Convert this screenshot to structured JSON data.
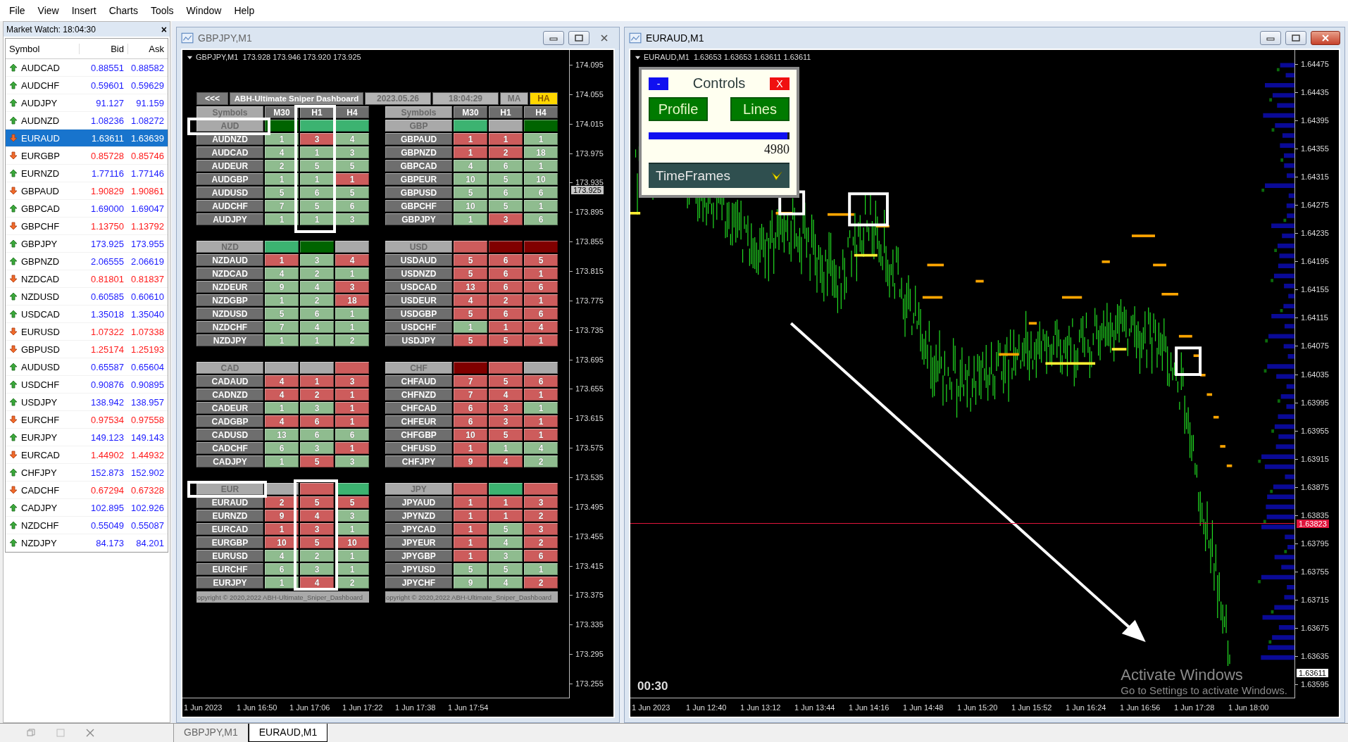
{
  "menu": [
    "File",
    "View",
    "Insert",
    "Charts",
    "Tools",
    "Window",
    "Help"
  ],
  "market_watch": {
    "title": "Market Watch: 18:04:30",
    "close": "×",
    "columns": [
      "Symbol",
      "Bid",
      "Ask"
    ],
    "rows": [
      {
        "symbol": "AUDCAD",
        "kind": "up",
        "bid": "0.88551",
        "ask": "0.88582",
        "selected": false
      },
      {
        "symbol": "AUDCHF",
        "kind": "up",
        "bid": "0.59601",
        "ask": "0.59629",
        "selected": false
      },
      {
        "symbol": "AUDJPY",
        "kind": "up",
        "bid": "91.127",
        "ask": "91.159",
        "selected": false
      },
      {
        "symbol": "AUDNZD",
        "kind": "up",
        "bid": "1.08236",
        "ask": "1.08272",
        "selected": false
      },
      {
        "symbol": "EURAUD",
        "kind": "down",
        "bid": "1.63611",
        "ask": "1.63639",
        "selected": true
      },
      {
        "symbol": "EURGBP",
        "kind": "down",
        "bid": "0.85728",
        "ask": "0.85746",
        "selected": false
      },
      {
        "symbol": "EURNZD",
        "kind": "up",
        "bid": "1.77116",
        "ask": "1.77146",
        "selected": false
      },
      {
        "symbol": "GBPAUD",
        "kind": "down",
        "bid": "1.90829",
        "ask": "1.90861",
        "selected": false
      },
      {
        "symbol": "GBPCAD",
        "kind": "up",
        "bid": "1.69000",
        "ask": "1.69047",
        "selected": false
      },
      {
        "symbol": "GBPCHF",
        "kind": "down",
        "bid": "1.13750",
        "ask": "1.13792",
        "selected": false
      },
      {
        "symbol": "GBPJPY",
        "kind": "up",
        "bid": "173.925",
        "ask": "173.955",
        "selected": false
      },
      {
        "symbol": "GBPNZD",
        "kind": "up",
        "bid": "2.06555",
        "ask": "2.06619",
        "selected": false
      },
      {
        "symbol": "NZDCAD",
        "kind": "down",
        "bid": "0.81801",
        "ask": "0.81837",
        "selected": false
      },
      {
        "symbol": "NZDUSD",
        "kind": "up",
        "bid": "0.60585",
        "ask": "0.60610",
        "selected": false
      },
      {
        "symbol": "USDCAD",
        "kind": "up",
        "bid": "1.35018",
        "ask": "1.35040",
        "selected": false
      },
      {
        "symbol": "EURUSD",
        "kind": "down",
        "bid": "1.07322",
        "ask": "1.07338",
        "selected": false
      },
      {
        "symbol": "GBPUSD",
        "kind": "down",
        "bid": "1.25174",
        "ask": "1.25193",
        "selected": false
      },
      {
        "symbol": "AUDUSD",
        "kind": "up",
        "bid": "0.65587",
        "ask": "0.65604",
        "selected": false
      },
      {
        "symbol": "USDCHF",
        "kind": "up",
        "bid": "0.90876",
        "ask": "0.90895",
        "selected": false
      },
      {
        "symbol": "USDJPY",
        "kind": "up",
        "bid": "138.942",
        "ask": "138.957",
        "selected": false
      },
      {
        "symbol": "EURCHF",
        "kind": "down",
        "bid": "0.97534",
        "ask": "0.97558",
        "selected": false
      },
      {
        "symbol": "EURJPY",
        "kind": "up",
        "bid": "149.123",
        "ask": "149.143",
        "selected": false
      },
      {
        "symbol": "EURCAD",
        "kind": "down",
        "bid": "1.44902",
        "ask": "1.44932",
        "selected": false
      },
      {
        "symbol": "CHFJPY",
        "kind": "up",
        "bid": "152.873",
        "ask": "152.902",
        "selected": false
      },
      {
        "symbol": "CADCHF",
        "kind": "down",
        "bid": "0.67294",
        "ask": "0.67328",
        "selected": false
      },
      {
        "symbol": "CADJPY",
        "kind": "up",
        "bid": "102.895",
        "ask": "102.926",
        "selected": false
      },
      {
        "symbol": "NZDCHF",
        "kind": "up",
        "bid": "0.55049",
        "ask": "0.55087",
        "selected": false
      },
      {
        "symbol": "NZDJPY",
        "kind": "up",
        "bid": "84.173",
        "ask": "84.201",
        "selected": false
      }
    ]
  },
  "charts": [
    {
      "title": "GBPJPY,M1",
      "info": "GBPJPY,M1  173.928 173.946 173.920 173.925",
      "price_ticks": [
        "174.095",
        "174.055",
        "174.015",
        "173.975",
        "173.935",
        "173.895",
        "173.855",
        "173.815",
        "173.775",
        "173.735",
        "173.695",
        "173.655",
        "173.615",
        "173.575",
        "173.535",
        "173.495",
        "173.455",
        "173.415",
        "173.375",
        "173.335",
        "173.295",
        "173.255"
      ],
      "current_price": "173.925",
      "time_ticks": [
        "1 Jun 2023",
        "1 Jun 16:50",
        "1 Jun 17:06",
        "1 Jun 17:22",
        "1 Jun 17:38",
        "1 Jun 17:54"
      ],
      "dashboard": {
        "back": "<<<",
        "title": "ABH-Ultimate Sniper Dashboard",
        "date": "2023.05.26",
        "time": "18:04:29",
        "modes": [
          {
            "label": "MA",
            "selected": false
          },
          {
            "label": "HA",
            "selected": true
          }
        ],
        "heads": [
          [
            "Symbols",
            "M30",
            "H1",
            "H4"
          ],
          [
            "Symbols",
            "M30",
            "H1",
            "H4"
          ]
        ],
        "groups": [
          {
            "currency": "AUD",
            "strength": [
              {
                "color": "#006400"
              },
              {
                "color": "#3cb371"
              },
              {
                "color": "#3cb371"
              }
            ],
            "rows": [
              {
                "pair": "AUDNZD",
                "cells": [
                  {
                    "text": "1",
                    "color": "#8fbc8f"
                  },
                  {
                    "text": "3",
                    "color": "#cd5c5c"
                  },
                  {
                    "text": "4",
                    "color": "#8fbc8f"
                  }
                ]
              },
              {
                "pair": "AUDCAD",
                "cells": [
                  {
                    "text": "4",
                    "color": "#8fbc8f"
                  },
                  {
                    "text": "1",
                    "color": "#8fbc8f"
                  },
                  {
                    "text": "3",
                    "color": "#8fbc8f"
                  }
                ]
              },
              {
                "pair": "AUDEUR",
                "cells": [
                  {
                    "text": "2",
                    "color": "#8fbc8f"
                  },
                  {
                    "text": "5",
                    "color": "#8fbc8f"
                  },
                  {
                    "text": "5",
                    "color": "#8fbc8f"
                  }
                ]
              },
              {
                "pair": "AUDGBP",
                "cells": [
                  {
                    "text": "1",
                    "color": "#8fbc8f"
                  },
                  {
                    "text": "1",
                    "color": "#8fbc8f"
                  },
                  {
                    "text": "1",
                    "color": "#cd5c5c"
                  }
                ]
              },
              {
                "pair": "AUDUSD",
                "cells": [
                  {
                    "text": "5",
                    "color": "#8fbc8f"
                  },
                  {
                    "text": "6",
                    "color": "#8fbc8f"
                  },
                  {
                    "text": "5",
                    "color": "#8fbc8f"
                  }
                ]
              },
              {
                "pair": "AUDCHF",
                "cells": [
                  {
                    "text": "7",
                    "color": "#8fbc8f"
                  },
                  {
                    "text": "5",
                    "color": "#8fbc8f"
                  },
                  {
                    "text": "6",
                    "color": "#8fbc8f"
                  }
                ]
              },
              {
                "pair": "AUDJPY",
                "cells": [
                  {
                    "text": "1",
                    "color": "#8fbc8f"
                  },
                  {
                    "text": "1",
                    "color": "#8fbc8f"
                  },
                  {
                    "text": "3",
                    "color": "#8fbc8f"
                  }
                ]
              }
            ]
          },
          {
            "currency": "GBP",
            "strength": [
              {
                "color": "#3cb371"
              },
              {
                "color": "#a9a9a9"
              },
              {
                "color": "#006400"
              }
            ],
            "rows": [
              {
                "pair": "GBPAUD",
                "cells": [
                  {
                    "text": "1",
                    "color": "#cd5c5c"
                  },
                  {
                    "text": "1",
                    "color": "#cd5c5c"
                  },
                  {
                    "text": "1",
                    "color": "#8fbc8f"
                  }
                ]
              },
              {
                "pair": "GBPNZD",
                "cells": [
                  {
                    "text": "1",
                    "color": "#cd5c5c"
                  },
                  {
                    "text": "2",
                    "color": "#cd5c5c"
                  },
                  {
                    "text": "18",
                    "color": "#8fbc8f"
                  }
                ]
              },
              {
                "pair": "GBPCAD",
                "cells": [
                  {
                    "text": "4",
                    "color": "#8fbc8f"
                  },
                  {
                    "text": "6",
                    "color": "#8fbc8f"
                  },
                  {
                    "text": "1",
                    "color": "#8fbc8f"
                  }
                ]
              },
              {
                "pair": "GBPEUR",
                "cells": [
                  {
                    "text": "10",
                    "color": "#8fbc8f"
                  },
                  {
                    "text": "5",
                    "color": "#8fbc8f"
                  },
                  {
                    "text": "10",
                    "color": "#8fbc8f"
                  }
                ]
              },
              {
                "pair": "GBPUSD",
                "cells": [
                  {
                    "text": "5",
                    "color": "#8fbc8f"
                  },
                  {
                    "text": "6",
                    "color": "#8fbc8f"
                  },
                  {
                    "text": "6",
                    "color": "#8fbc8f"
                  }
                ]
              },
              {
                "pair": "GBPCHF",
                "cells": [
                  {
                    "text": "10",
                    "color": "#8fbc8f"
                  },
                  {
                    "text": "5",
                    "color": "#8fbc8f"
                  },
                  {
                    "text": "1",
                    "color": "#8fbc8f"
                  }
                ]
              },
              {
                "pair": "GBPJPY",
                "cells": [
                  {
                    "text": "1",
                    "color": "#8fbc8f"
                  },
                  {
                    "text": "3",
                    "color": "#cd5c5c"
                  },
                  {
                    "text": "6",
                    "color": "#8fbc8f"
                  }
                ]
              }
            ]
          },
          {
            "currency": "NZD",
            "strength": [
              {
                "color": "#3cb371"
              },
              {
                "color": "#006400"
              },
              {
                "color": "#a9a9a9"
              }
            ],
            "rows": [
              {
                "pair": "NZDAUD",
                "cells": [
                  {
                    "text": "1",
                    "color": "#cd5c5c"
                  },
                  {
                    "text": "3",
                    "color": "#8fbc8f"
                  },
                  {
                    "text": "4",
                    "color": "#cd5c5c"
                  }
                ]
              },
              {
                "pair": "NZDCAD",
                "cells": [
                  {
                    "text": "4",
                    "color": "#8fbc8f"
                  },
                  {
                    "text": "2",
                    "color": "#8fbc8f"
                  },
                  {
                    "text": "1",
                    "color": "#8fbc8f"
                  }
                ]
              },
              {
                "pair": "NZDEUR",
                "cells": [
                  {
                    "text": "9",
                    "color": "#8fbc8f"
                  },
                  {
                    "text": "4",
                    "color": "#8fbc8f"
                  },
                  {
                    "text": "3",
                    "color": "#cd5c5c"
                  }
                ]
              },
              {
                "pair": "NZDGBP",
                "cells": [
                  {
                    "text": "1",
                    "color": "#8fbc8f"
                  },
                  {
                    "text": "2",
                    "color": "#8fbc8f"
                  },
                  {
                    "text": "18",
                    "color": "#cd5c5c"
                  }
                ]
              },
              {
                "pair": "NZDUSD",
                "cells": [
                  {
                    "text": "5",
                    "color": "#8fbc8f"
                  },
                  {
                    "text": "6",
                    "color": "#8fbc8f"
                  },
                  {
                    "text": "1",
                    "color": "#8fbc8f"
                  }
                ]
              },
              {
                "pair": "NZDCHF",
                "cells": [
                  {
                    "text": "7",
                    "color": "#8fbc8f"
                  },
                  {
                    "text": "4",
                    "color": "#8fbc8f"
                  },
                  {
                    "text": "1",
                    "color": "#8fbc8f"
                  }
                ]
              },
              {
                "pair": "NZDJPY",
                "cells": [
                  {
                    "text": "1",
                    "color": "#8fbc8f"
                  },
                  {
                    "text": "1",
                    "color": "#8fbc8f"
                  },
                  {
                    "text": "2",
                    "color": "#8fbc8f"
                  }
                ]
              }
            ]
          },
          {
            "currency": "USD",
            "strength": [
              {
                "color": "#cd5c5c"
              },
              {
                "color": "#800000"
              },
              {
                "color": "#800000"
              }
            ],
            "rows": [
              {
                "pair": "USDAUD",
                "cells": [
                  {
                    "text": "5",
                    "color": "#cd5c5c"
                  },
                  {
                    "text": "6",
                    "color": "#cd5c5c"
                  },
                  {
                    "text": "5",
                    "color": "#cd5c5c"
                  }
                ]
              },
              {
                "pair": "USDNZD",
                "cells": [
                  {
                    "text": "5",
                    "color": "#cd5c5c"
                  },
                  {
                    "text": "6",
                    "color": "#cd5c5c"
                  },
                  {
                    "text": "1",
                    "color": "#cd5c5c"
                  }
                ]
              },
              {
                "pair": "USDCAD",
                "cells": [
                  {
                    "text": "13",
                    "color": "#cd5c5c"
                  },
                  {
                    "text": "6",
                    "color": "#cd5c5c"
                  },
                  {
                    "text": "6",
                    "color": "#cd5c5c"
                  }
                ]
              },
              {
                "pair": "USDEUR",
                "cells": [
                  {
                    "text": "4",
                    "color": "#cd5c5c"
                  },
                  {
                    "text": "2",
                    "color": "#cd5c5c"
                  },
                  {
                    "text": "1",
                    "color": "#cd5c5c"
                  }
                ]
              },
              {
                "pair": "USDGBP",
                "cells": [
                  {
                    "text": "5",
                    "color": "#cd5c5c"
                  },
                  {
                    "text": "6",
                    "color": "#cd5c5c"
                  },
                  {
                    "text": "6",
                    "color": "#cd5c5c"
                  }
                ]
              },
              {
                "pair": "USDCHF",
                "cells": [
                  {
                    "text": "1",
                    "color": "#8fbc8f"
                  },
                  {
                    "text": "1",
                    "color": "#cd5c5c"
                  },
                  {
                    "text": "4",
                    "color": "#cd5c5c"
                  }
                ]
              },
              {
                "pair": "USDJPY",
                "cells": [
                  {
                    "text": "5",
                    "color": "#cd5c5c"
                  },
                  {
                    "text": "5",
                    "color": "#cd5c5c"
                  },
                  {
                    "text": "1",
                    "color": "#cd5c5c"
                  }
                ]
              }
            ]
          },
          {
            "currency": "CAD",
            "strength": [
              {
                "color": "#a9a9a9"
              },
              {
                "color": "#a9a9a9"
              },
              {
                "color": "#cd5c5c"
              }
            ],
            "rows": [
              {
                "pair": "CADAUD",
                "cells": [
                  {
                    "text": "4",
                    "color": "#cd5c5c"
                  },
                  {
                    "text": "1",
                    "color": "#cd5c5c"
                  },
                  {
                    "text": "3",
                    "color": "#cd5c5c"
                  }
                ]
              },
              {
                "pair": "CADNZD",
                "cells": [
                  {
                    "text": "4",
                    "color": "#cd5c5c"
                  },
                  {
                    "text": "2",
                    "color": "#cd5c5c"
                  },
                  {
                    "text": "1",
                    "color": "#cd5c5c"
                  }
                ]
              },
              {
                "pair": "CADEUR",
                "cells": [
                  {
                    "text": "1",
                    "color": "#8fbc8f"
                  },
                  {
                    "text": "3",
                    "color": "#8fbc8f"
                  },
                  {
                    "text": "1",
                    "color": "#cd5c5c"
                  }
                ]
              },
              {
                "pair": "CADGBP",
                "cells": [
                  {
                    "text": "4",
                    "color": "#cd5c5c"
                  },
                  {
                    "text": "6",
                    "color": "#cd5c5c"
                  },
                  {
                    "text": "1",
                    "color": "#cd5c5c"
                  }
                ]
              },
              {
                "pair": "CADUSD",
                "cells": [
                  {
                    "text": "13",
                    "color": "#8fbc8f"
                  },
                  {
                    "text": "6",
                    "color": "#8fbc8f"
                  },
                  {
                    "text": "6",
                    "color": "#8fbc8f"
                  }
                ]
              },
              {
                "pair": "CADCHF",
                "cells": [
                  {
                    "text": "6",
                    "color": "#8fbc8f"
                  },
                  {
                    "text": "3",
                    "color": "#8fbc8f"
                  },
                  {
                    "text": "1",
                    "color": "#cd5c5c"
                  }
                ]
              },
              {
                "pair": "CADJPY",
                "cells": [
                  {
                    "text": "1",
                    "color": "#8fbc8f"
                  },
                  {
                    "text": "5",
                    "color": "#cd5c5c"
                  },
                  {
                    "text": "3",
                    "color": "#8fbc8f"
                  }
                ]
              }
            ]
          },
          {
            "currency": "CHF",
            "strength": [
              {
                "color": "#800000"
              },
              {
                "color": "#cd5c5c"
              },
              {
                "color": "#a9a9a9"
              }
            ],
            "rows": [
              {
                "pair": "CHFAUD",
                "cells": [
                  {
                    "text": "7",
                    "color": "#cd5c5c"
                  },
                  {
                    "text": "5",
                    "color": "#cd5c5c"
                  },
                  {
                    "text": "6",
                    "color": "#cd5c5c"
                  }
                ]
              },
              {
                "pair": "CHFNZD",
                "cells": [
                  {
                    "text": "7",
                    "color": "#cd5c5c"
                  },
                  {
                    "text": "4",
                    "color": "#cd5c5c"
                  },
                  {
                    "text": "1",
                    "color": "#cd5c5c"
                  }
                ]
              },
              {
                "pair": "CHFCAD",
                "cells": [
                  {
                    "text": "6",
                    "color": "#cd5c5c"
                  },
                  {
                    "text": "3",
                    "color": "#cd5c5c"
                  },
                  {
                    "text": "1",
                    "color": "#8fbc8f"
                  }
                ]
              },
              {
                "pair": "CHFEUR",
                "cells": [
                  {
                    "text": "6",
                    "color": "#cd5c5c"
                  },
                  {
                    "text": "3",
                    "color": "#cd5c5c"
                  },
                  {
                    "text": "1",
                    "color": "#cd5c5c"
                  }
                ]
              },
              {
                "pair": "CHFGBP",
                "cells": [
                  {
                    "text": "10",
                    "color": "#cd5c5c"
                  },
                  {
                    "text": "5",
                    "color": "#cd5c5c"
                  },
                  {
                    "text": "1",
                    "color": "#cd5c5c"
                  }
                ]
              },
              {
                "pair": "CHFUSD",
                "cells": [
                  {
                    "text": "1",
                    "color": "#cd5c5c"
                  },
                  {
                    "text": "1",
                    "color": "#8fbc8f"
                  },
                  {
                    "text": "4",
                    "color": "#8fbc8f"
                  }
                ]
              },
              {
                "pair": "CHFJPY",
                "cells": [
                  {
                    "text": "9",
                    "color": "#cd5c5c"
                  },
                  {
                    "text": "4",
                    "color": "#cd5c5c"
                  },
                  {
                    "text": "2",
                    "color": "#8fbc8f"
                  }
                ]
              }
            ]
          },
          {
            "currency": "EUR",
            "strength": [
              {
                "color": "#a9a9a9"
              },
              {
                "color": "#cd5c5c"
              },
              {
                "color": "#3cb371"
              }
            ],
            "rows": [
              {
                "pair": "EURAUD",
                "cells": [
                  {
                    "text": "2",
                    "color": "#cd5c5c"
                  },
                  {
                    "text": "5",
                    "color": "#cd5c5c"
                  },
                  {
                    "text": "5",
                    "color": "#cd5c5c"
                  }
                ]
              },
              {
                "pair": "EURNZD",
                "cells": [
                  {
                    "text": "9",
                    "color": "#cd5c5c"
                  },
                  {
                    "text": "4",
                    "color": "#cd5c5c"
                  },
                  {
                    "text": "3",
                    "color": "#8fbc8f"
                  }
                ]
              },
              {
                "pair": "EURCAD",
                "cells": [
                  {
                    "text": "1",
                    "color": "#cd5c5c"
                  },
                  {
                    "text": "3",
                    "color": "#cd5c5c"
                  },
                  {
                    "text": "1",
                    "color": "#8fbc8f"
                  }
                ]
              },
              {
                "pair": "EURGBP",
                "cells": [
                  {
                    "text": "10",
                    "color": "#cd5c5c"
                  },
                  {
                    "text": "5",
                    "color": "#cd5c5c"
                  },
                  {
                    "text": "10",
                    "color": "#cd5c5c"
                  }
                ]
              },
              {
                "pair": "EURUSD",
                "cells": [
                  {
                    "text": "4",
                    "color": "#8fbc8f"
                  },
                  {
                    "text": "2",
                    "color": "#8fbc8f"
                  },
                  {
                    "text": "1",
                    "color": "#8fbc8f"
                  }
                ]
              },
              {
                "pair": "EURCHF",
                "cells": [
                  {
                    "text": "6",
                    "color": "#8fbc8f"
                  },
                  {
                    "text": "3",
                    "color": "#8fbc8f"
                  },
                  {
                    "text": "1",
                    "color": "#8fbc8f"
                  }
                ]
              },
              {
                "pair": "EURJPY",
                "cells": [
                  {
                    "text": "1",
                    "color": "#8fbc8f"
                  },
                  {
                    "text": "4",
                    "color": "#cd5c5c"
                  },
                  {
                    "text": "2",
                    "color": "#8fbc8f"
                  }
                ]
              }
            ]
          },
          {
            "currency": "JPY",
            "strength": [
              {
                "color": "#cd5c5c"
              },
              {
                "color": "#3cb371"
              },
              {
                "color": "#cd5c5c"
              }
            ],
            "rows": [
              {
                "pair": "JPYAUD",
                "cells": [
                  {
                    "text": "1",
                    "color": "#cd5c5c"
                  },
                  {
                    "text": "1",
                    "color": "#cd5c5c"
                  },
                  {
                    "text": "3",
                    "color": "#cd5c5c"
                  }
                ]
              },
              {
                "pair": "JPYNZD",
                "cells": [
                  {
                    "text": "1",
                    "color": "#cd5c5c"
                  },
                  {
                    "text": "1",
                    "color": "#cd5c5c"
                  },
                  {
                    "text": "2",
                    "color": "#cd5c5c"
                  }
                ]
              },
              {
                "pair": "JPYCAD",
                "cells": [
                  {
                    "text": "1",
                    "color": "#cd5c5c"
                  },
                  {
                    "text": "5",
                    "color": "#8fbc8f"
                  },
                  {
                    "text": "3",
                    "color": "#cd5c5c"
                  }
                ]
              },
              {
                "pair": "JPYEUR",
                "cells": [
                  {
                    "text": "1",
                    "color": "#cd5c5c"
                  },
                  {
                    "text": "4",
                    "color": "#8fbc8f"
                  },
                  {
                    "text": "2",
                    "color": "#cd5c5c"
                  }
                ]
              },
              {
                "pair": "JPYGBP",
                "cells": [
                  {
                    "text": "1",
                    "color": "#cd5c5c"
                  },
                  {
                    "text": "3",
                    "color": "#8fbc8f"
                  },
                  {
                    "text": "6",
                    "color": "#cd5c5c"
                  }
                ]
              },
              {
                "pair": "JPYUSD",
                "cells": [
                  {
                    "text": "5",
                    "color": "#8fbc8f"
                  },
                  {
                    "text": "5",
                    "color": "#8fbc8f"
                  },
                  {
                    "text": "1",
                    "color": "#8fbc8f"
                  }
                ]
              },
              {
                "pair": "JPYCHF",
                "cells": [
                  {
                    "text": "9",
                    "color": "#8fbc8f"
                  },
                  {
                    "text": "4",
                    "color": "#8fbc8f"
                  },
                  {
                    "text": "2",
                    "color": "#cd5c5c"
                  }
                ]
              }
            ]
          }
        ],
        "footers": [
          "opyright © 2020,2022 ABH-Ultimate_Sniper_Dashboard",
          "opyright © 2020,2022 ABH-Ultimate_Sniper_Dashboard"
        ]
      }
    },
    {
      "title": "EURAUD,M1",
      "info": "EURAUD,M1  1.63653 1.63653 1.63611 1.63611",
      "price_ticks": [
        "1.64475",
        "1.64435",
        "1.64395",
        "1.64355",
        "1.64315",
        "1.64275",
        "1.64235",
        "1.64195",
        "1.64155",
        "1.64115",
        "1.64075",
        "1.64035",
        "1.63995",
        "1.63955",
        "1.63915",
        "1.63875",
        "1.63835",
        "1.63795",
        "1.63755",
        "1.63715",
        "1.63675",
        "1.63635",
        "1.63595"
      ],
      "line_price": "1.63823",
      "current_price": "1.63611",
      "time_ticks": [
        "1 Jun 2023",
        "1 Jun 12:40",
        "1 Jun 13:12",
        "1 Jun 13:44",
        "1 Jun 14:16",
        "1 Jun 14:48",
        "1 Jun 15:20",
        "1 Jun 15:52",
        "1 Jun 16:24",
        "1 Jun 16:56",
        "1 Jun 17:28",
        "1 Jun 18:00"
      ],
      "countdown": "00:30",
      "controls": {
        "minimize": "-",
        "title": "Controls",
        "close": "X",
        "buttons": [
          "Profile",
          "Lines"
        ],
        "level": 1,
        "value": "4980",
        "dropdown": "TimeFrames"
      }
    }
  ],
  "tabs": [
    {
      "label": "GBPJPY,M1",
      "selected": false
    },
    {
      "label": "EURAUD,M1",
      "selected": true
    }
  ],
  "os_notice": {
    "title": "Activate Windows",
    "text": "Go to Settings to activate Windows."
  }
}
